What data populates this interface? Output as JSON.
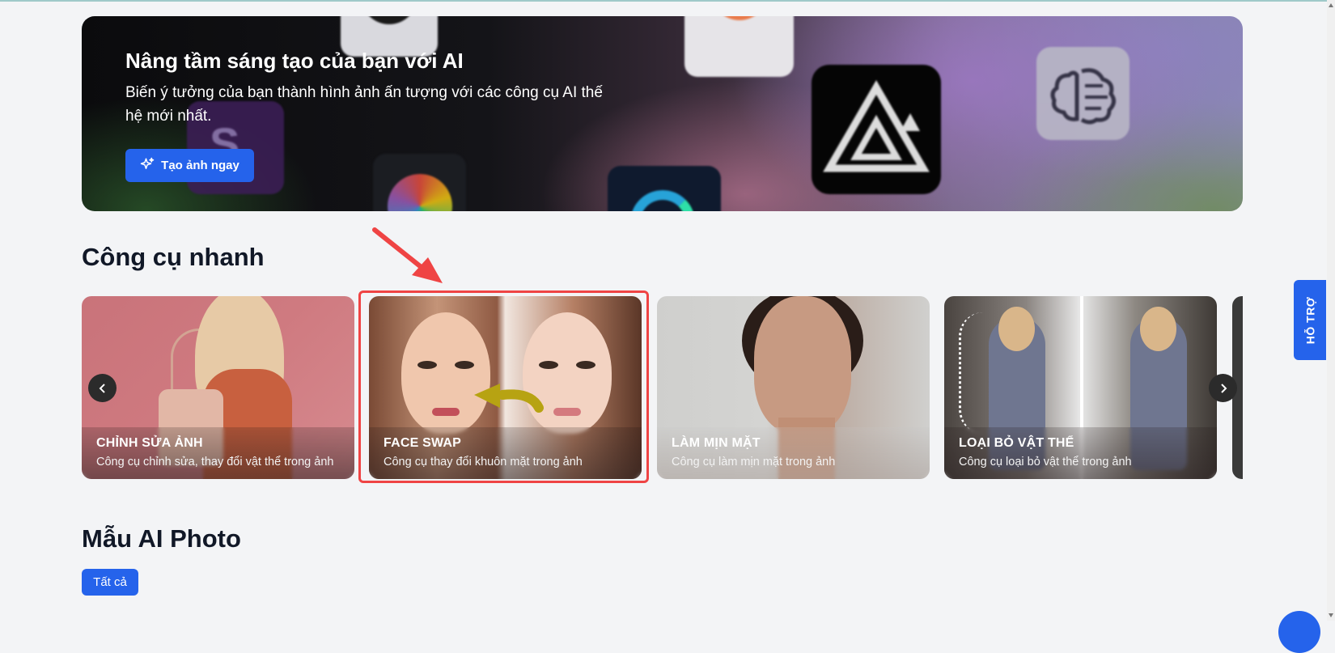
{
  "hero": {
    "title": "Nâng tầm sáng tạo của bạn với AI",
    "subtitle": "Biến ý tưởng của bạn thành hình ảnh ấn tượng với các công cụ AI thế hệ mới nhất.",
    "cta_label": "Tạo ảnh ngay",
    "cta_icon": "sparkles-icon"
  },
  "quick_tools": {
    "heading": "Công cụ nhanh",
    "cards": [
      {
        "title": "CHỈNH SỬA ẢNH",
        "description": "Công cụ chỉnh sửa, thay đổi vật thể trong ảnh"
      },
      {
        "title": "FACE SWAP",
        "description": "Công cụ thay đổi khuôn mặt trong ảnh"
      },
      {
        "title": "LÀM MỊN MẶT",
        "description": "Công cụ làm mịn mặt trong ảnh"
      },
      {
        "title": "LOẠI BỎ VẬT THỂ",
        "description": "Công cụ loại bỏ vật thể trong ảnh"
      }
    ]
  },
  "ai_photo": {
    "heading": "Mẫu AI Photo",
    "filter_all": "Tất cả"
  },
  "support": {
    "label": "HỖ TRỢ"
  },
  "colors": {
    "primary": "#2563eb",
    "highlight": "#ef4444",
    "background": "#f3f4f6"
  }
}
